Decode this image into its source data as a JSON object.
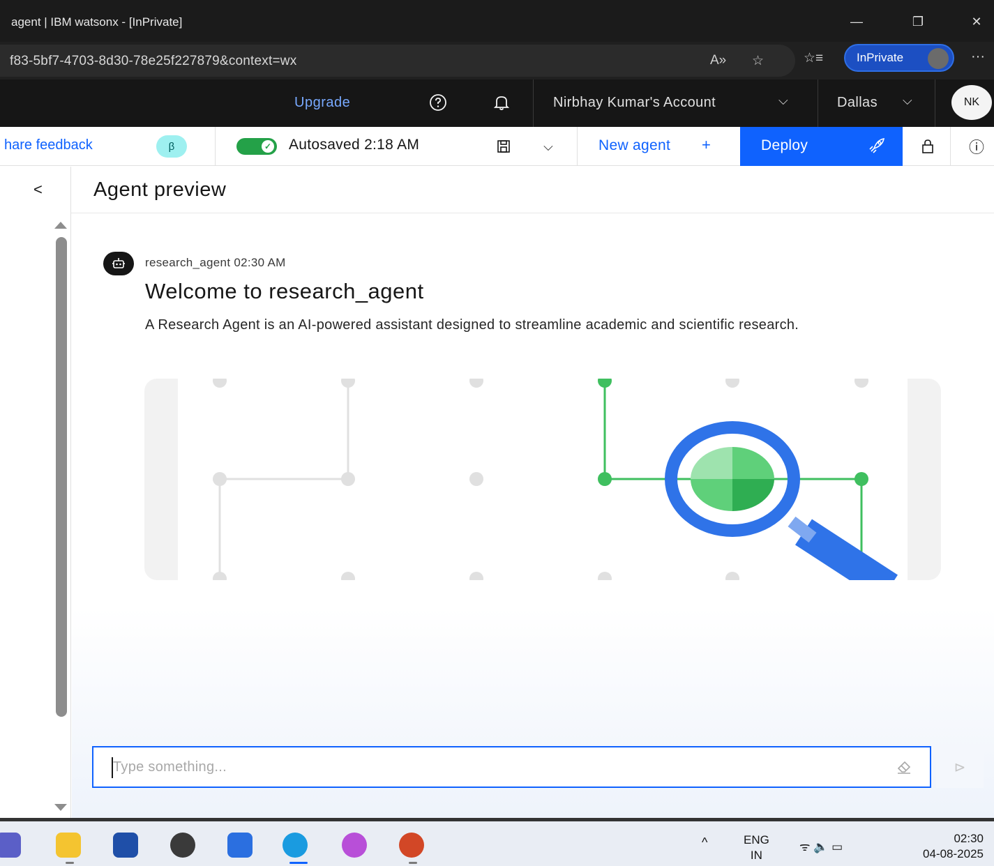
{
  "browser": {
    "window_title": "agent | IBM watsonx - [InPrivate]",
    "url": "f83-5bf7-4703-8d30-78e25f227879&context=wx",
    "inprivate_label": "InPrivate",
    "minimize_glyph": "—",
    "restore_glyph": "❐",
    "close_glyph": "✕",
    "more_glyph": "···",
    "read_aloud_glyph": "A»",
    "favorite_glyph": "☆",
    "favorites_glyph": "☆≡"
  },
  "header": {
    "upgrade_label": "Upgrade",
    "account_label": "Nirbhay Kumar's Account",
    "region_label": "Dallas",
    "avatar_initials": "NK",
    "chevron_glyph": "⌵"
  },
  "toolbar": {
    "share_feedback_label": "hare feedback",
    "beta_badge": "β",
    "autosave_status": "Autosaved 2:18 AM",
    "new_agent_label": "New agent",
    "new_agent_plus": "+",
    "deploy_label": "Deploy",
    "dropdown_glyph": "⌵",
    "info_glyph": "ⓘ"
  },
  "preview": {
    "back_glyph": "<",
    "title": "Agent preview"
  },
  "chat": {
    "message": {
      "sender": "research_agent",
      "time": "02:30 AM",
      "heading": "Welcome to research_agent",
      "body": "A Research Agent is an AI-powered assistant designed to streamline academic and scientific research."
    },
    "input": {
      "placeholder": "Type something...",
      "value": ""
    },
    "send_glyph": "⊳"
  },
  "taskbar": {
    "tray_chevron": "^",
    "language_line1": "ENG",
    "language_line2": "IN",
    "tray_icons": "ᯤ  🔈  ▭",
    "clock_time": "02:30",
    "clock_date": "04-08-2025"
  },
  "colors": {
    "ibm_blue": "#0f62fe",
    "header_bg": "#161616",
    "autosave_green": "#24a148",
    "illustration_green": "#3fbf5f",
    "illustration_blue": "#2f73e8"
  },
  "icons": {
    "help": "help-icon",
    "notification": "bell-icon",
    "save": "save-icon",
    "rocket": "rocket-icon",
    "lock": "lock-icon",
    "info": "info-icon",
    "bot": "bot-icon",
    "eraser": "eraser-icon",
    "send": "send-icon",
    "magnifier": "magnifier-illustration"
  }
}
